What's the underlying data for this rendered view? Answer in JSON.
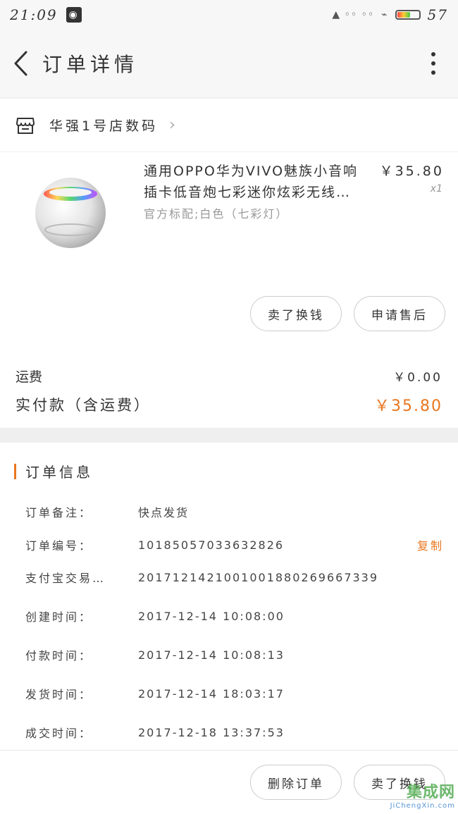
{
  "status_bar": {
    "time": "21:09",
    "battery_level": "57",
    "battery_fraction": 0.57
  },
  "app_bar": {
    "title": "订单详情"
  },
  "store": {
    "name": "华强1号店数码"
  },
  "product": {
    "title": "通用OPPO华为VIVO魅族小音响插卡低音炮七彩迷你炫彩无线…",
    "spec": "官方标配;白色（七彩灯）",
    "price": "￥35.80",
    "quantity": "x1"
  },
  "actions": {
    "sell_label": "卖了换钱",
    "refund_label": "申请售后"
  },
  "fees": {
    "shipping_label": "运费",
    "shipping_value": "￥0.00",
    "paid_label": "实付款（含运费）",
    "paid_value": "￥35.80"
  },
  "order_info": {
    "section_title": "订单信息",
    "copy_label": "复制",
    "rows": [
      {
        "label": "订单备注：",
        "value": "快点发货"
      },
      {
        "label": "订单编号：",
        "value": "10185057033632826"
      },
      {
        "label": "支付宝交易…",
        "value": "2017121421001001880269667339"
      },
      {
        "label": "创建时间：",
        "value": "2017-12-14 10:08:00"
      },
      {
        "label": "付款时间：",
        "value": "2017-12-14 10:08:13"
      },
      {
        "label": "发货时间：",
        "value": "2017-12-14 18:03:17"
      },
      {
        "label": "成交时间：",
        "value": "2017-12-18 13:37:53"
      }
    ]
  },
  "bottom_bar": {
    "delete_label": "删除订单",
    "sell_label": "卖了换钱"
  },
  "watermark": {
    "text": "集成网",
    "url": "JiChengXin.com"
  },
  "colors": {
    "accent": "#e8761f",
    "background": "#efefef",
    "card": "#ffffff"
  }
}
